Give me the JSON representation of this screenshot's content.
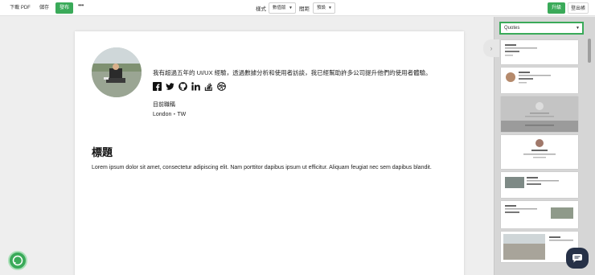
{
  "toolbar": {
    "download_pdf": "下載 PDF",
    "save": "儲存",
    "publish": "發布",
    "more": "•••",
    "style_label": "樣式",
    "style_value": "數值版",
    "spacing_label": "間距",
    "spacing_value": "預設",
    "upgrade": "升級",
    "logout": "登出帳"
  },
  "resume": {
    "bio": "我有超過五年的 UI/UX 經驗，透過數據分析和使用者訪談，我已經幫助許多公司提升他們的使用者體驗。",
    "socials": [
      "facebook-icon",
      "twitter-icon",
      "github-icon",
      "linkedin-icon",
      "stackoverflow-icon",
      "dribbble-icon"
    ],
    "job_title": "目前職稱",
    "location": "London・TW",
    "section_title": "標題",
    "section_body": "Lorem ipsum dolor sit amet, consectetur adipiscing elit. Nam porttitor dapibus ipsum ut efficitur. Aliquam feugiat nec sem dapibus blandit."
  },
  "panel": {
    "template_select": "Quotes",
    "collapse_glyph": "›"
  },
  "colors": {
    "accent": "#3aaa59",
    "chat": "#263147"
  }
}
